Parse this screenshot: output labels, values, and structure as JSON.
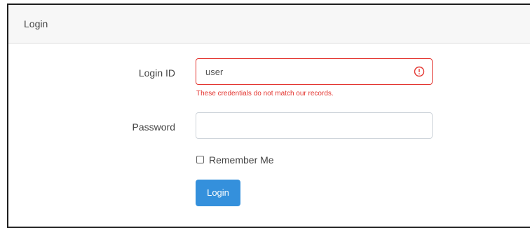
{
  "card": {
    "title": "Login"
  },
  "form": {
    "login_id": {
      "label": "Login ID",
      "value": "user",
      "error": "These credentials do not match our records.",
      "error_icon": "exclamation-circle-icon"
    },
    "password": {
      "label": "Password",
      "value": ""
    },
    "remember": {
      "label": "Remember Me",
      "checked": false
    },
    "submit_label": "Login"
  },
  "colors": {
    "error": "#e3342f",
    "primary": "#3490dc",
    "header_bg": "#f7f7f7"
  }
}
